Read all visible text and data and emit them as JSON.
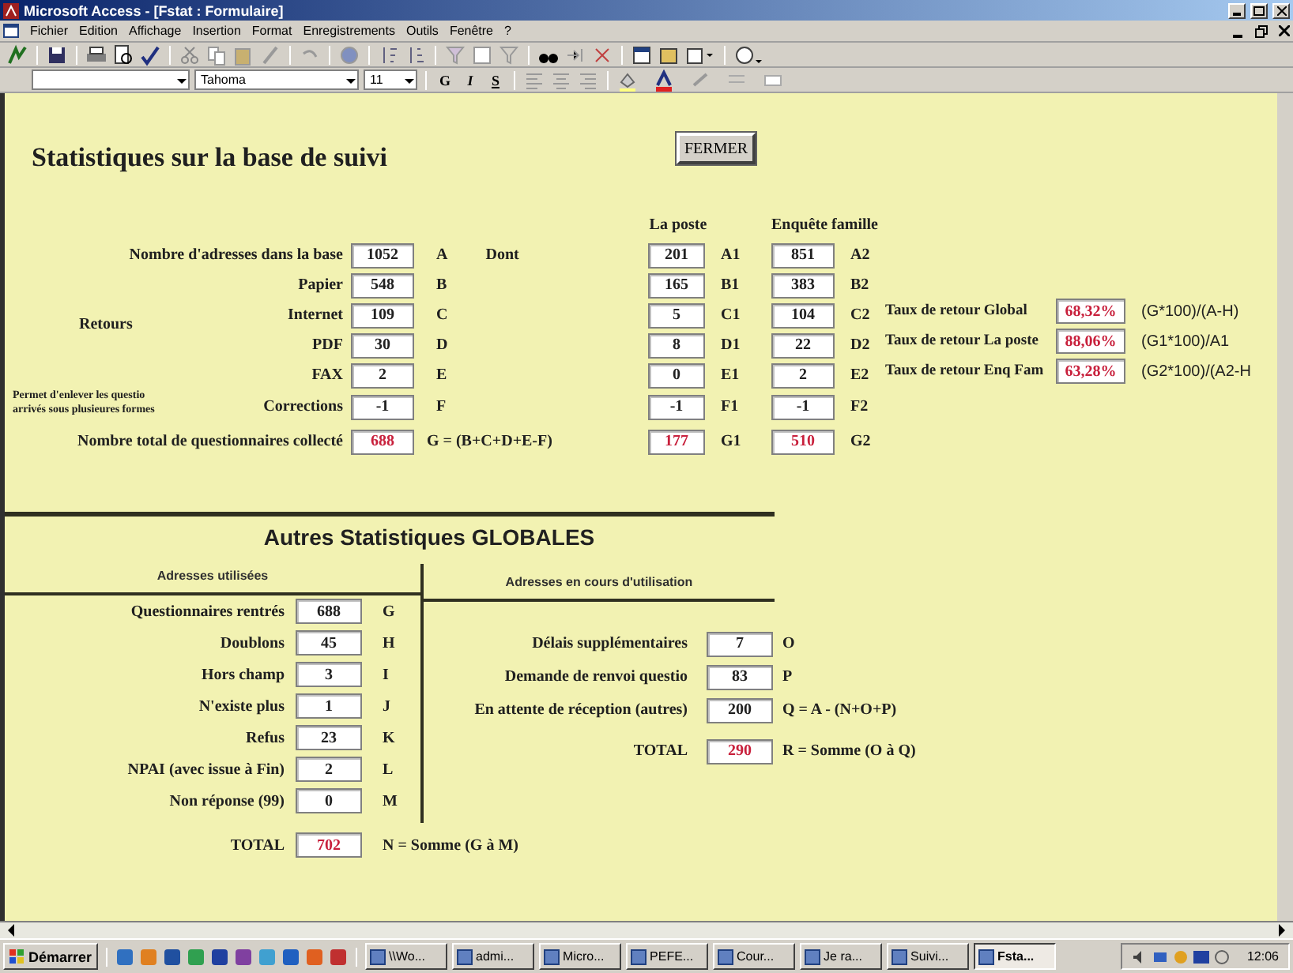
{
  "window": {
    "title": "Microsoft Access - [Fstat : Formulaire]"
  },
  "menu": [
    "Fichier",
    "Edition",
    "Affichage",
    "Insertion",
    "Format",
    "Enregistrements",
    "Outils",
    "Fenêtre",
    "?"
  ],
  "format_toolbar": {
    "font": "Tahoma",
    "size": "11",
    "style_buttons": [
      "G",
      "I",
      "S"
    ]
  },
  "form": {
    "title": "Statistiques sur la base de suivi",
    "close_button": "FERMER",
    "columns": [
      "La poste",
      "Enquête famille"
    ],
    "group_label": "Retours",
    "note": [
      "Permet d'enlever les questio",
      "arrivés sous plusieures formes"
    ],
    "rows": [
      {
        "label": "Nombre d'adresses dans la base",
        "value": "1052",
        "code": "A",
        "extra": "Dont",
        "poste": "201",
        "poste_code": "A1",
        "famille": "851",
        "famille_code": "A2",
        "highlighted": false
      },
      {
        "label": "Papier",
        "value": "548",
        "code": "B",
        "poste": "165",
        "poste_code": "B1",
        "famille": "383",
        "famille_code": "B2",
        "highlighted": false
      },
      {
        "label": "Internet",
        "value": "109",
        "code": "C",
        "poste": "5",
        "poste_code": "C1",
        "famille": "104",
        "famille_code": "C2",
        "highlighted": false
      },
      {
        "label": "PDF",
        "value": "30",
        "code": "D",
        "poste": "8",
        "poste_code": "D1",
        "famille": "22",
        "famille_code": "D2",
        "highlighted": false
      },
      {
        "label": "FAX",
        "value": "2",
        "code": "E",
        "poste": "0",
        "poste_code": "E1",
        "famille": "2",
        "famille_code": "E2",
        "highlighted": false
      },
      {
        "label": "Corrections",
        "value": "-1",
        "code": "F",
        "poste": "-1",
        "poste_code": "F1",
        "famille": "-1",
        "famille_code": "F2",
        "highlighted": false
      },
      {
        "label": "Nombre total de questionnaires collecté",
        "value": "688",
        "code": "G = (B+C+D+E-F)",
        "poste": "177",
        "poste_code": "G1",
        "famille": "510",
        "famille_code": "G2",
        "highlighted": true
      }
    ],
    "rates": [
      {
        "label": "Taux de retour Global",
        "value": "68,32%",
        "formula": "(G*100)/(A-H)",
        "highlighted": true
      },
      {
        "label": "Taux de retour La poste",
        "value": "88,06%",
        "formula": "(G1*100)/A1",
        "highlighted": true
      },
      {
        "label": "Taux de retour Enq Fam",
        "value": "63,28%",
        "formula": "(G2*100)/(A2-H",
        "highlighted": true
      }
    ],
    "global": {
      "title": "Autres Statistiques GLOBALES",
      "left": {
        "heading": "Adresses utilisées",
        "rows": [
          {
            "label": "Questionnaires rentrés",
            "value": "688",
            "code": "G",
            "highlighted": false
          },
          {
            "label": "Doublons",
            "value": "45",
            "code": "H",
            "highlighted": false
          },
          {
            "label": "Hors champ",
            "value": "3",
            "code": "I",
            "highlighted": false
          },
          {
            "label": "N'existe plus",
            "value": "1",
            "code": "J",
            "highlighted": false
          },
          {
            "label": "Refus",
            "value": "23",
            "code": "K",
            "highlighted": false
          },
          {
            "label": "NPAI (avec issue à Fin)",
            "value": "2",
            "code": "L",
            "highlighted": false
          },
          {
            "label": "Non réponse (99)",
            "value": "0",
            "code": "M",
            "highlighted": false
          }
        ],
        "total": {
          "label": "TOTAL",
          "value": "702",
          "code": "N = Somme (G à M)",
          "highlighted": true
        }
      },
      "right": {
        "heading": "Adresses en cours d'utilisation",
        "rows": [
          {
            "label": "Délais supplémentaires",
            "value": "7",
            "code": "O",
            "highlighted": false
          },
          {
            "label": "Demande de renvoi questio",
            "value": "83",
            "code": "P",
            "highlighted": false
          },
          {
            "label": "En attente de réception (autres)",
            "value": "200",
            "code": "Q = A - (N+O+P)",
            "highlighted": false
          }
        ],
        "total": {
          "label": "TOTAL",
          "value": "290",
          "code": "R = Somme (O à Q)",
          "highlighted": true
        }
      }
    }
  },
  "taskbar": {
    "start": "Démarrer",
    "tasks": [
      {
        "label": "\\\\Wo...",
        "selected": false
      },
      {
        "label": "admi...",
        "selected": false
      },
      {
        "label": "Micro...",
        "selected": false
      },
      {
        "label": "PEFE...",
        "selected": false
      },
      {
        "label": "Cour...",
        "selected": false
      },
      {
        "label": "Je ra...",
        "selected": false
      },
      {
        "label": "Suivi...",
        "selected": false
      },
      {
        "label": "Fsta...",
        "selected": true
      }
    ],
    "clock": "12:06"
  }
}
